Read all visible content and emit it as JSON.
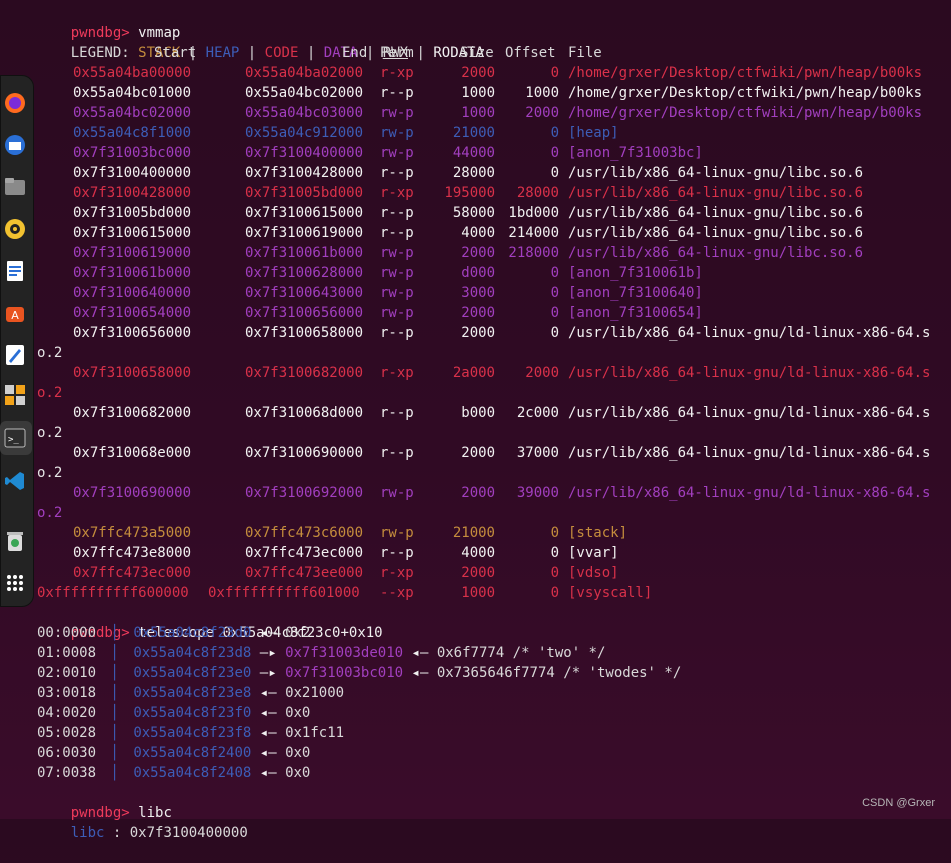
{
  "prompt": "pwndbg>",
  "commands": {
    "vmmap": "vmmap",
    "telescope": "telescope 0x55a04c8f23c0+0x10",
    "libc": "libc"
  },
  "legend": {
    "label": "LEGEND:",
    "items": [
      "STACK",
      "HEAP",
      "CODE",
      "DATA",
      "RWX",
      "RODATA"
    ],
    "sep": "|"
  },
  "vmmap_header": {
    "start": "Start",
    "end": "End",
    "perm": "Perm",
    "size": "Size",
    "offset": "Offset",
    "file": "File"
  },
  "vmmap_rows": [
    {
      "start": "0x55a04ba00000",
      "end": "0x55a04ba02000",
      "perm": "r-xp",
      "size": "2000",
      "offset": "0",
      "file": "/home/grxer/Desktop/ctfwiki/pwn/heap/b00ks",
      "cls": "c-red"
    },
    {
      "start": "0x55a04bc01000",
      "end": "0x55a04bc02000",
      "perm": "r--p",
      "size": "1000",
      "offset": "1000",
      "file": "/home/grxer/Desktop/ctfwiki/pwn/heap/b00ks",
      "cls": "c-white"
    },
    {
      "start": "0x55a04bc02000",
      "end": "0x55a04bc03000",
      "perm": "rw-p",
      "size": "1000",
      "offset": "2000",
      "file": "/home/grxer/Desktop/ctfwiki/pwn/heap/b00ks",
      "cls": "c-purple"
    },
    {
      "start": "0x55a04c8f1000",
      "end": "0x55a04c912000",
      "perm": "rw-p",
      "size": "21000",
      "offset": "0",
      "file": "[heap]",
      "cls": "c-blue"
    },
    {
      "start": "0x7f31003bc000",
      "end": "0x7f3100400000",
      "perm": "rw-p",
      "size": "44000",
      "offset": "0",
      "file": "[anon_7f31003bc]",
      "cls": "c-purple"
    },
    {
      "start": "0x7f3100400000",
      "end": "0x7f3100428000",
      "perm": "r--p",
      "size": "28000",
      "offset": "0",
      "file": "/usr/lib/x86_64-linux-gnu/libc.so.6",
      "cls": "c-white"
    },
    {
      "start": "0x7f3100428000",
      "end": "0x7f31005bd000",
      "perm": "r-xp",
      "size": "195000",
      "offset": "28000",
      "file": "/usr/lib/x86_64-linux-gnu/libc.so.6",
      "cls": "c-red"
    },
    {
      "start": "0x7f31005bd000",
      "end": "0x7f3100615000",
      "perm": "r--p",
      "size": "58000",
      "offset": "1bd000",
      "file": "/usr/lib/x86_64-linux-gnu/libc.so.6",
      "cls": "c-white"
    },
    {
      "start": "0x7f3100615000",
      "end": "0x7f3100619000",
      "perm": "r--p",
      "size": "4000",
      "offset": "214000",
      "file": "/usr/lib/x86_64-linux-gnu/libc.so.6",
      "cls": "c-white"
    },
    {
      "start": "0x7f3100619000",
      "end": "0x7f310061b000",
      "perm": "rw-p",
      "size": "2000",
      "offset": "218000",
      "file": "/usr/lib/x86_64-linux-gnu/libc.so.6",
      "cls": "c-purple"
    },
    {
      "start": "0x7f310061b000",
      "end": "0x7f3100628000",
      "perm": "rw-p",
      "size": "d000",
      "offset": "0",
      "file": "[anon_7f310061b]",
      "cls": "c-purple"
    },
    {
      "start": "0x7f3100640000",
      "end": "0x7f3100643000",
      "perm": "rw-p",
      "size": "3000",
      "offset": "0",
      "file": "[anon_7f3100640]",
      "cls": "c-purple"
    },
    {
      "start": "0x7f3100654000",
      "end": "0x7f3100656000",
      "perm": "rw-p",
      "size": "2000",
      "offset": "0",
      "file": "[anon_7f3100654]",
      "cls": "c-purple"
    },
    {
      "start": "0x7f3100656000",
      "end": "0x7f3100658000",
      "perm": "r--p",
      "size": "2000",
      "offset": "0",
      "file": "/usr/lib/x86_64-linux-gnu/ld-linux-x86-64.s",
      "wrap": "o.2",
      "cls": "c-white"
    },
    {
      "start": "0x7f3100658000",
      "end": "0x7f3100682000",
      "perm": "r-xp",
      "size": "2a000",
      "offset": "2000",
      "file": "/usr/lib/x86_64-linux-gnu/ld-linux-x86-64.s",
      "wrap": "o.2",
      "cls": "c-red"
    },
    {
      "start": "0x7f3100682000",
      "end": "0x7f310068d000",
      "perm": "r--p",
      "size": "b000",
      "offset": "2c000",
      "file": "/usr/lib/x86_64-linux-gnu/ld-linux-x86-64.s",
      "wrap": "o.2",
      "cls": "c-white"
    },
    {
      "start": "0x7f310068e000",
      "end": "0x7f3100690000",
      "perm": "r--p",
      "size": "2000",
      "offset": "37000",
      "file": "/usr/lib/x86_64-linux-gnu/ld-linux-x86-64.s",
      "wrap": "o.2",
      "cls": "c-white"
    },
    {
      "start": "0x7f3100690000",
      "end": "0x7f3100692000",
      "perm": "rw-p",
      "size": "2000",
      "offset": "39000",
      "file": "/usr/lib/x86_64-linux-gnu/ld-linux-x86-64.s",
      "wrap": "o.2",
      "cls": "c-purple"
    },
    {
      "start": "0x7ffc473a5000",
      "end": "0x7ffc473c6000",
      "perm": "rw-p",
      "size": "21000",
      "offset": "0",
      "file": "[stack]",
      "cls": "c-stack"
    },
    {
      "start": "0x7ffc473e8000",
      "end": "0x7ffc473ec000",
      "perm": "r--p",
      "size": "4000",
      "offset": "0",
      "file": "[vvar]",
      "cls": "c-white"
    },
    {
      "start": "0x7ffc473ec000",
      "end": "0x7ffc473ee000",
      "perm": "r-xp",
      "size": "2000",
      "offset": "0",
      "file": "[vdso]",
      "cls": "c-red"
    },
    {
      "start": "0xffffffffff600000",
      "end": "0xffffffffff601000",
      "perm": "--xp",
      "size": "1000",
      "offset": "0",
      "file": "[vsyscall]",
      "cls": "c-red"
    }
  ],
  "telescope_rows": [
    {
      "idx": "00:0000",
      "addr": "0x55a04c8f23d0",
      "arrow": "◂—",
      "value": "0x2"
    },
    {
      "idx": "01:0008",
      "addr": "0x55a04c8f23d8",
      "arrow": "—▸",
      "ptr": "0x7f31003de010",
      "arrow2": "◂—",
      "value": "0x6f7774 /* 'two' */"
    },
    {
      "idx": "02:0010",
      "addr": "0x55a04c8f23e0",
      "arrow": "—▸",
      "ptr": "0x7f31003bc010",
      "arrow2": "◂—",
      "value": "0x7365646f7774 /* 'twodes' */"
    },
    {
      "idx": "03:0018",
      "addr": "0x55a04c8f23e8",
      "arrow": "◂—",
      "value": "0x21000"
    },
    {
      "idx": "04:0020",
      "addr": "0x55a04c8f23f0",
      "arrow": "◂—",
      "value": "0x0"
    },
    {
      "idx": "05:0028",
      "addr": "0x55a04c8f23f8",
      "arrow": "◂—",
      "value": "0x1fc11"
    },
    {
      "idx": "06:0030",
      "addr": "0x55a04c8f2400",
      "arrow": "◂—",
      "value": "0x0"
    },
    {
      "idx": "07:0038",
      "addr": "0x55a04c8f2408",
      "arrow": "◂—",
      "value": "0x0"
    }
  ],
  "libc_result": {
    "label": "libc",
    "sep": ":",
    "value": "0x7f3100400000"
  },
  "watermark": "CSDN @Grxer",
  "dock_icons": [
    "firefox-icon",
    "thunderbird-icon",
    "files-icon",
    "rhythmbox-icon",
    "writer-icon",
    "app-center-icon",
    "text-editor-icon",
    "calculator-icon",
    "terminal-icon",
    "vscode-icon",
    "trash-icon",
    "app-grid-icon"
  ],
  "colors": {
    "bg": "#300a24",
    "stack": "#c58d3d",
    "heap": "#3d5db7",
    "code": "#d9314a",
    "data": "#a23fbf",
    "prompt": "#ef3b5b"
  }
}
